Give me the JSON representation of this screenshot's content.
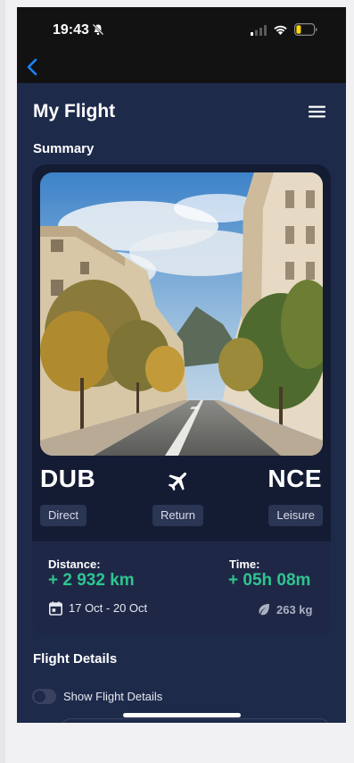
{
  "status_bar": {
    "time": "19:43"
  },
  "header": {
    "title": "My Flight"
  },
  "summary": {
    "section_title": "Summary",
    "origin": "DUB",
    "destination": "NCE",
    "tags": [
      "Direct",
      "Return",
      "Leisure"
    ],
    "distance_label": "Distance:",
    "distance_value": "+ 2 932 km",
    "time_label": "Time:",
    "time_value": "+ 05h 08m",
    "dates": "17 Oct - 20 Oct",
    "co2": "263 kg"
  },
  "details": {
    "section_title": "Flight Details",
    "toggle_label": "Show Flight Details",
    "toggle_on": false
  },
  "colors": {
    "background": "#1e2a4a",
    "card": "#141c34",
    "accent_green": "#2ec58f",
    "status_bar": "#121212",
    "link_blue": "#1a84ff"
  },
  "icons": {
    "back": "chevron-left-icon",
    "menu": "hamburger-menu-icon",
    "plane": "airplane-icon",
    "calendar": "calendar-icon",
    "leaf": "leaf-icon",
    "silent": "bell-slash-icon",
    "signal": "cellular-signal-icon",
    "wifi": "wifi-icon",
    "battery": "battery-icon"
  }
}
